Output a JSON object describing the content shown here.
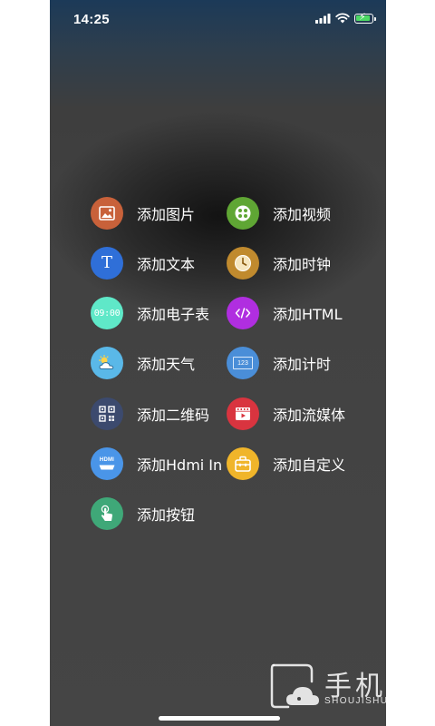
{
  "status_bar": {
    "time": "14:25"
  },
  "menu": {
    "items": [
      {
        "label": "添加图片",
        "icon": "image-icon",
        "color": "#c8613a"
      },
      {
        "label": "添加视频",
        "icon": "video-icon",
        "color": "#5fa634"
      },
      {
        "label": "添加文本",
        "icon": "text-icon",
        "color": "#2f6fd8"
      },
      {
        "label": "添加时钟",
        "icon": "clock-icon",
        "color": "#c08a2e"
      },
      {
        "label": "添加电子表",
        "icon": "digital-clock-icon",
        "color": "#5fe8c8"
      },
      {
        "label": "添加HTML",
        "icon": "html-code-icon",
        "color": "#b02ee0"
      },
      {
        "label": "添加天气",
        "icon": "weather-icon",
        "color": "#5ab8e8"
      },
      {
        "label": "添加计时",
        "icon": "timer-icon",
        "color": "#4a8ed8"
      },
      {
        "label": "添加二维码",
        "icon": "qr-code-icon",
        "color": "#3c4a6e"
      },
      {
        "label": "添加流媒体",
        "icon": "stream-media-icon",
        "color": "#d9343f"
      },
      {
        "label": "添加Hdmi In",
        "icon": "hdmi-icon",
        "color": "#4a95e8"
      },
      {
        "label": "添加自定义",
        "icon": "custom-box-icon",
        "color": "#f0b52a"
      },
      {
        "label": "添加按钮",
        "icon": "touch-button-icon",
        "color": "#3fa878"
      }
    ]
  },
  "icon_text": {
    "digital_clock": "09:00",
    "hdmi": "HDMI",
    "timer": "123"
  },
  "watermark": {
    "title": "手机鼠",
    "subtitle": "SHOUJISHU.COM"
  },
  "colors": {
    "battery_fill": "#4cd964",
    "background_dark": "#424242"
  }
}
